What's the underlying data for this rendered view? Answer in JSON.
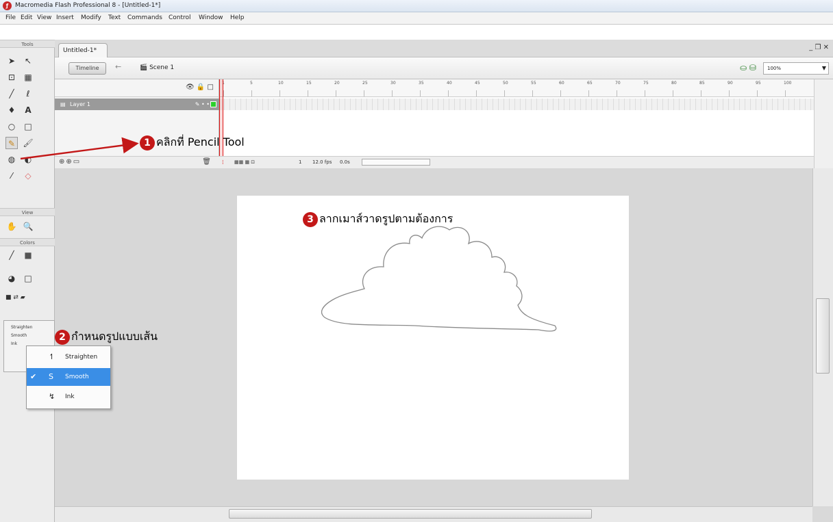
{
  "window": {
    "title": "Macromedia Flash Professional 8 - [Untitled-1*]",
    "icon": "flash-app-icon"
  },
  "menu": [
    "File",
    "Edit",
    "View",
    "Insert",
    "Modify",
    "Text",
    "Commands",
    "Control",
    "Window",
    "Help"
  ],
  "toolbox": {
    "header": "Tools",
    "view_label": "View",
    "colors_label": "Colors"
  },
  "document": {
    "tab_label": "Untitled-1*",
    "window_controls": "_ ❐ ✕",
    "timeline_button": "Timeline",
    "scene_label": "Scene 1",
    "zoom_value": "100%"
  },
  "timeline": {
    "layer_name": "Layer 1",
    "ruler_ticks": [
      "1",
      "5",
      "10",
      "15",
      "20",
      "25",
      "30",
      "35",
      "40",
      "45",
      "50",
      "55",
      "60",
      "65",
      "70",
      "75",
      "80",
      "85",
      "90",
      "95",
      "100"
    ],
    "status": {
      "frame": "1",
      "fps": "12.0 fps",
      "time": "0.0s"
    }
  },
  "pencil_mode_menu": {
    "items": [
      {
        "label": "Straighten",
        "selected": false
      },
      {
        "label": "Smooth",
        "selected": true
      },
      {
        "label": "Ink",
        "selected": false
      }
    ],
    "flyout_labels": [
      "Straighten",
      "Smooth",
      "Ink"
    ]
  },
  "annotations": {
    "step1": {
      "number": "1",
      "text": "คลิกที่ Pencil Tool"
    },
    "step2": {
      "number": "2",
      "text": "กำหนดรูปแบบเส้น"
    },
    "step3": {
      "number": "3",
      "text": "ลากเมาส์วาดรูปตามต้องการ"
    }
  },
  "colors": {
    "annotation_arrow": "#c31818",
    "selection_highlight": "#3a8ee6",
    "stroke": "#8a8a8a"
  }
}
